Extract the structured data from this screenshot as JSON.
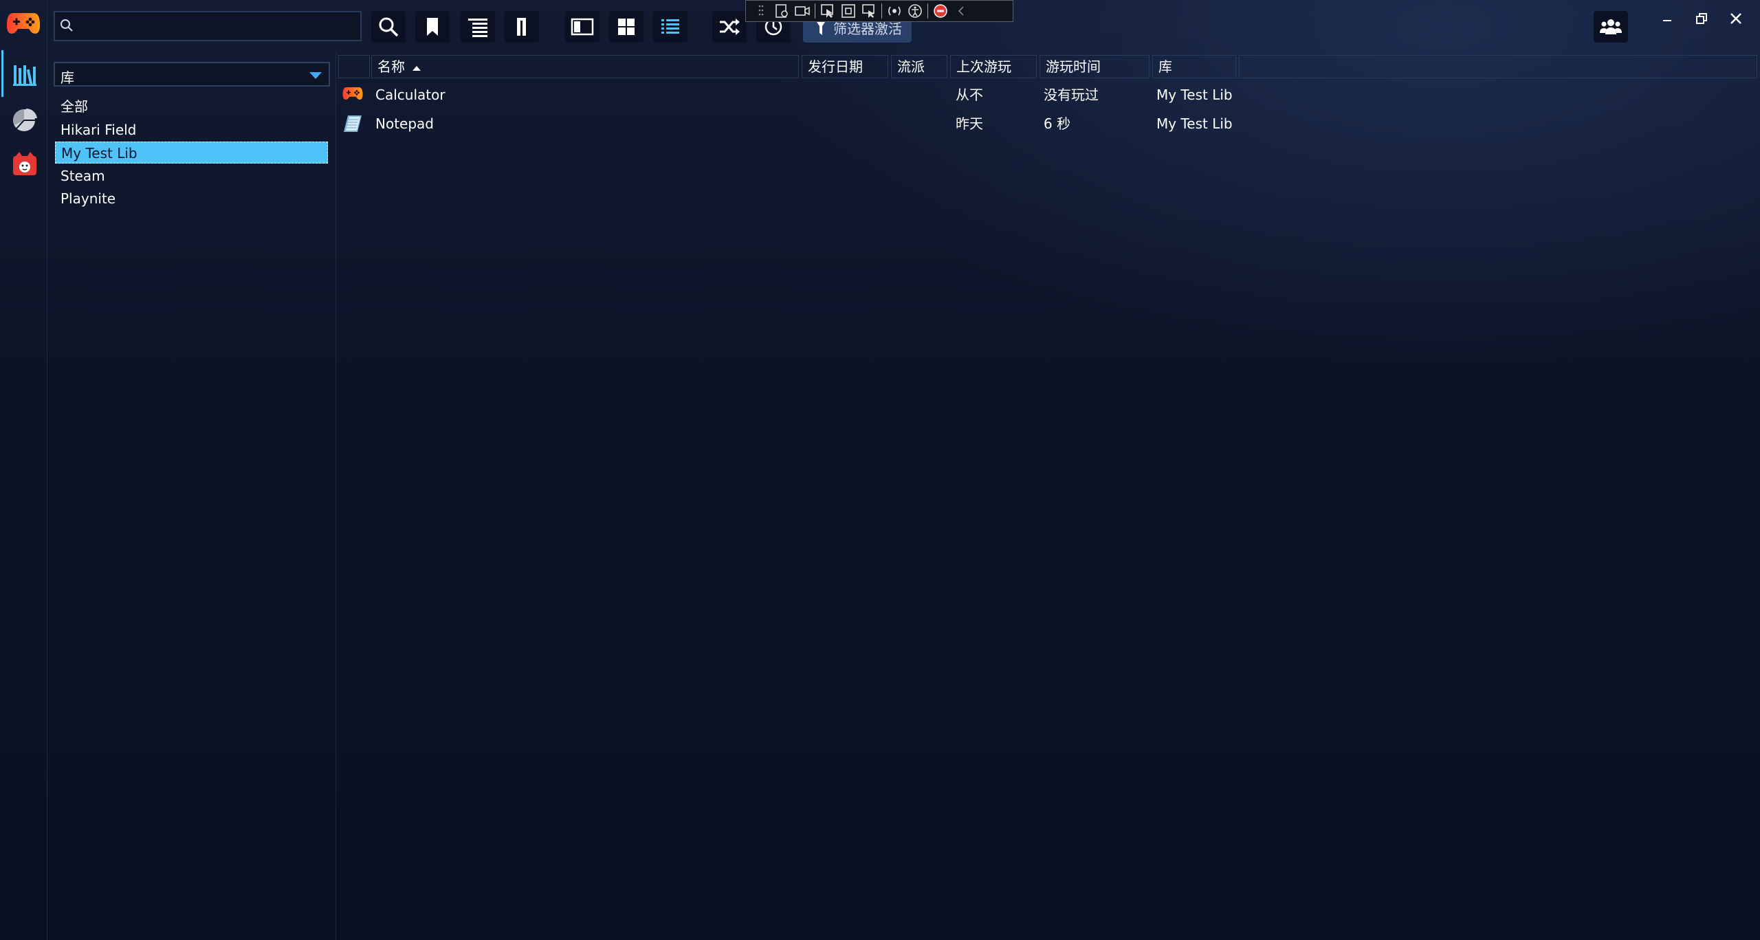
{
  "app": {
    "brand_icon": "gamepad-logo",
    "accent": "#4fc3f7"
  },
  "search": {
    "value": "",
    "placeholder": ""
  },
  "toolbar": {
    "buttons": [
      "search-icon",
      "bookmark-icon",
      "tree-list-icon",
      "sidebar-toggle-icon",
      "panel-toggle-icon",
      "grid-view-icon",
      "list-view-icon",
      "shuffle-icon",
      "clock-icon"
    ],
    "filter_label": "筛选器激活"
  },
  "left_rail": {
    "items": [
      "library-icon",
      "stats-pie-icon",
      "cat-face-icon"
    ]
  },
  "library_select": {
    "value": "库"
  },
  "libraries": [
    "全部",
    "Hikari Field",
    "My Test Lib",
    "Steam",
    "Playnite"
  ],
  "selected_library_index": 2,
  "table": {
    "headers": {
      "name": "名称",
      "release_date": "发行日期",
      "genre": "流派",
      "last_played": "上次游玩",
      "playtime": "游玩时间",
      "library": "库"
    },
    "rows": [
      {
        "icon": "gamepad-icon",
        "name": "Calculator",
        "release_date": "",
        "genre": "",
        "last_played": "从不",
        "playtime": "没有玩过",
        "library": "My Test Lib"
      },
      {
        "icon": "notepad-icon",
        "name": "Notepad",
        "release_date": "",
        "genre": "",
        "last_played": "昨天",
        "playtime": "6 秒",
        "library": "My Test Lib"
      }
    ]
  }
}
